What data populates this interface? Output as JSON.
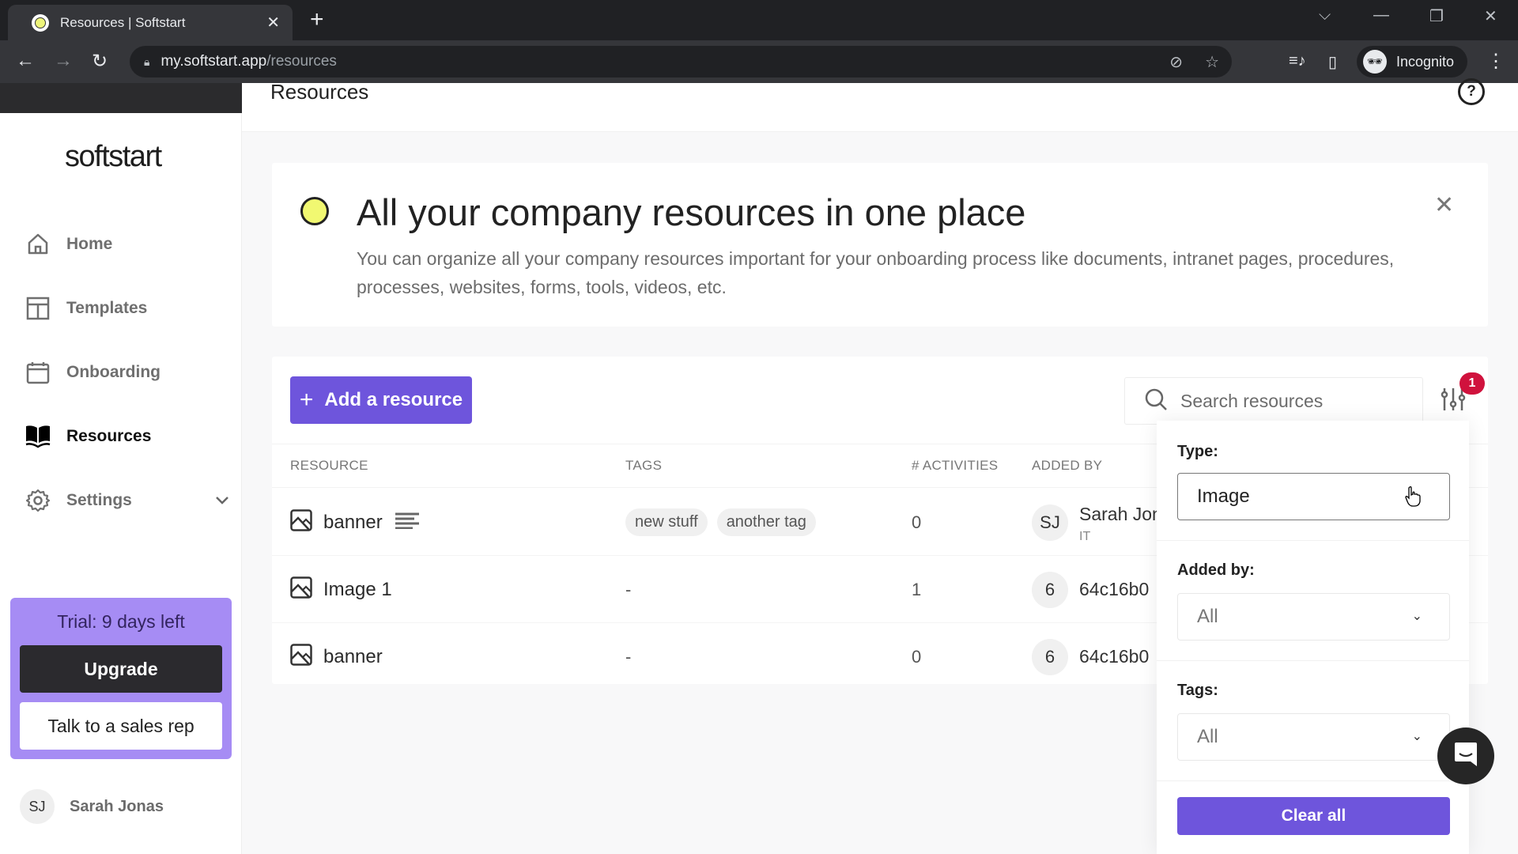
{
  "browser": {
    "tab_title": "Resources | Softstart",
    "url_host": "my.softstart.app",
    "url_path": "/resources",
    "profile_label": "Incognito"
  },
  "app": {
    "logo": "softstart",
    "page_title": "Resources"
  },
  "sidebar": {
    "items": [
      {
        "label": "Home",
        "icon": "home-icon"
      },
      {
        "label": "Templates",
        "icon": "templates-icon"
      },
      {
        "label": "Onboarding",
        "icon": "calendar-icon"
      },
      {
        "label": "Resources",
        "icon": "book-icon",
        "active": true
      },
      {
        "label": "Settings",
        "icon": "gear-icon",
        "expandable": true
      }
    ],
    "trial": {
      "text": "Trial: 9 days left",
      "upgrade_label": "Upgrade",
      "sales_label": "Talk to a sales rep"
    },
    "user": {
      "initials": "SJ",
      "name": "Sarah Jonas"
    }
  },
  "banner": {
    "title": "All your company resources in one place",
    "description": "You can organize all your company resources important for your onboarding process like documents, intranet pages, procedures, processes, websites, forms, tools, videos, etc."
  },
  "toolbar": {
    "add_label": "Add a resource",
    "search_placeholder": "Search resources",
    "filter_count": "1"
  },
  "table": {
    "headers": [
      "RESOURCE",
      "TAGS",
      "# ACTIVITIES",
      "ADDED BY"
    ],
    "rows": [
      {
        "name": "banner",
        "has_description": true,
        "tags": [
          "new stuff",
          "another tag"
        ],
        "tags_text": "",
        "activities": "0",
        "added_by_initials": "SJ",
        "added_by_name": "Sarah Jonas",
        "added_by_sub": "IT"
      },
      {
        "name": "Image 1",
        "has_description": false,
        "tags": [],
        "tags_text": "-",
        "activities": "1",
        "added_by_initials": "6",
        "added_by_name": "64c16b0",
        "added_by_sub": ""
      },
      {
        "name": "banner",
        "has_description": false,
        "tags": [],
        "tags_text": "-",
        "activities": "0",
        "added_by_initials": "6",
        "added_by_name": "64c16b0",
        "added_by_sub": ""
      }
    ]
  },
  "filters": {
    "type_label": "Type:",
    "type_value": "Image",
    "added_by_label": "Added by:",
    "added_by_value": "All",
    "tags_label": "Tags:",
    "tags_value": "All",
    "clear_label": "Clear all"
  },
  "colors": {
    "accent": "#6e55dc",
    "trial_bg": "#a68cf4",
    "badge": "#d0123d",
    "banner_dot": "#f1f871"
  }
}
